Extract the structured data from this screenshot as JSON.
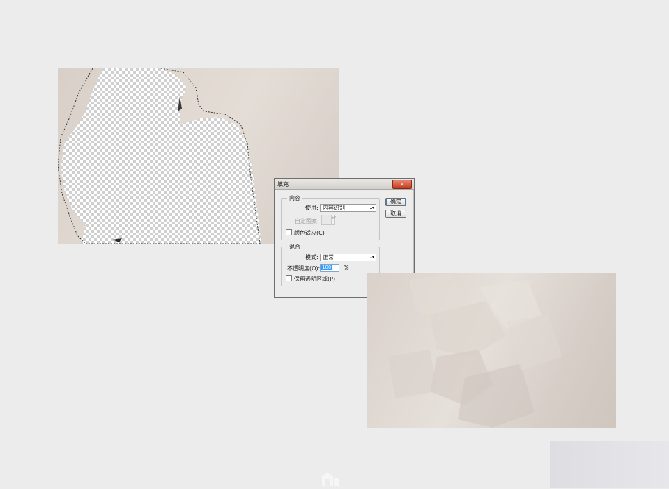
{
  "dialog": {
    "title": "填充",
    "close_glyph": "×",
    "content_section": {
      "legend": "内容",
      "use_label": "使用:",
      "use_value": "内容识别",
      "pattern_label": "自定图案:",
      "color_adapt_label": "颜色适应(C)",
      "color_adapt_checked": false
    },
    "blend_section": {
      "legend": "混合",
      "mode_label": "模式:",
      "mode_value": "正常",
      "opacity_label": "不透明度(O):",
      "opacity_value": "100",
      "opacity_unit": "%",
      "preserve_label": "保留透明区域(P)",
      "preserve_checked": false
    },
    "ok_label": "确定",
    "cancel_label": "取消"
  },
  "icons": {
    "dropdown": "dropdown-arrow-icon",
    "spin": "spinner-icon",
    "watermark": "site-logo-icon"
  },
  "colors": {
    "canvas_beige": "#e2dbd4",
    "selection_blue": "#3399ff",
    "close_red": "#c43d21"
  }
}
